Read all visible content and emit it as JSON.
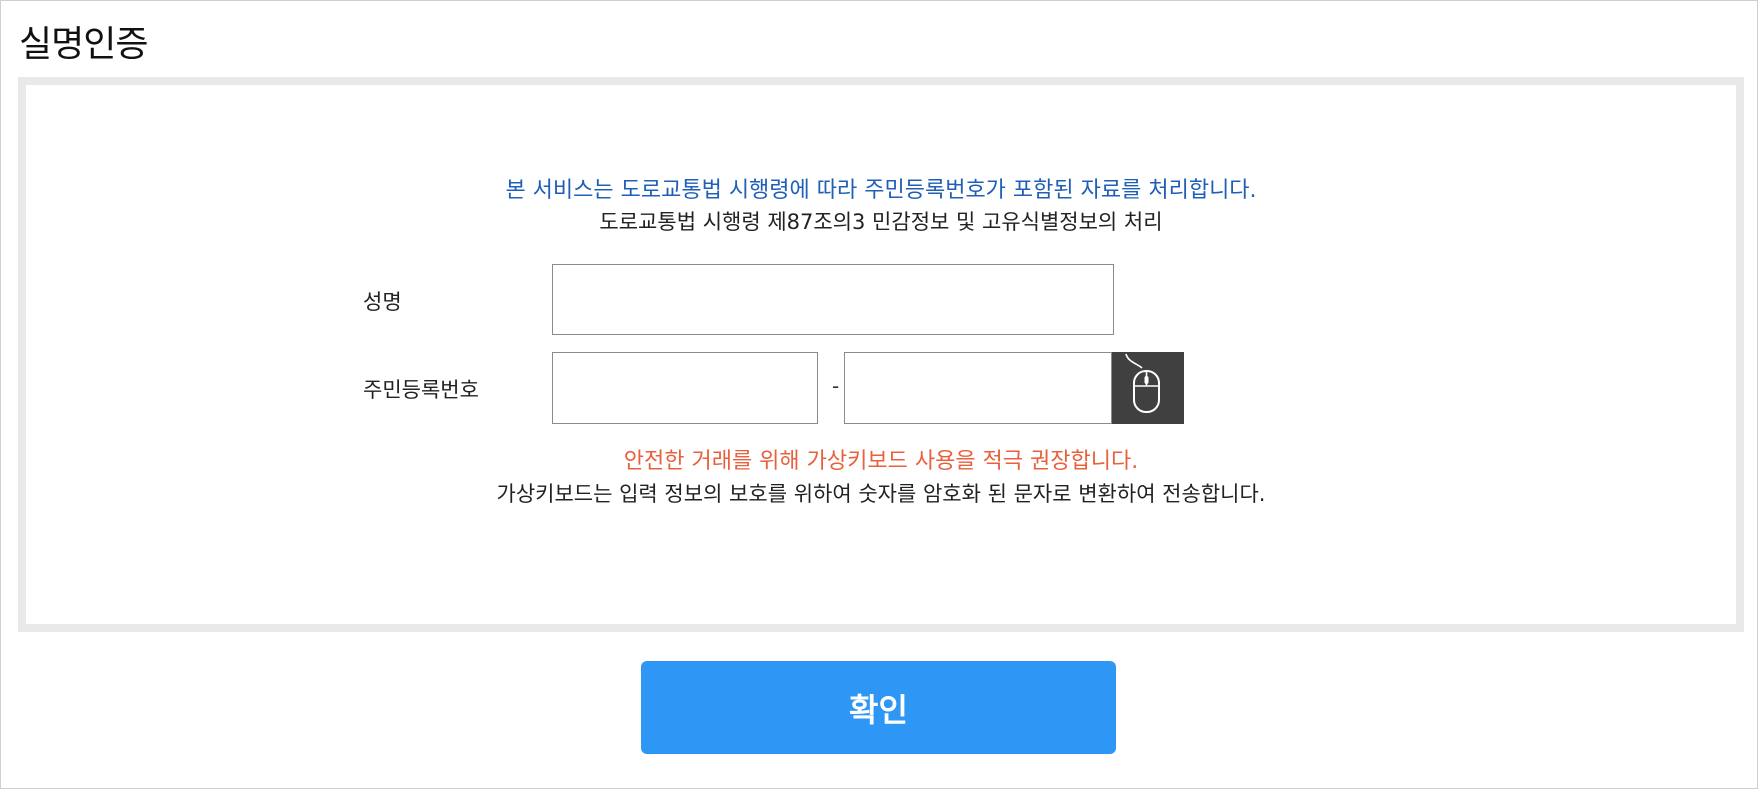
{
  "page": {
    "title": "실명인증"
  },
  "notice": {
    "service_text": "본 서비스는 도로교통법 시행령에 따라 주민등록번호가 포함된 자료를 처리합니다.",
    "legal_text": "도로교통법 시행령 제87조의3 민감정보 및 고유식별정보의 처리"
  },
  "form": {
    "name_label": "성명",
    "name_value": "",
    "rrn_label": "주민등록번호",
    "rrn_front_value": "",
    "rrn_separator": "-",
    "rrn_back_value": "",
    "virtual_keyboard_icon": "mouse-icon"
  },
  "security": {
    "warning_text": "안전한 거래를 위해 가상키보드 사용을 적극 권장합니다.",
    "info_text": "가상키보드는 입력 정보의 보호를 위하여 숫자를 암호화 된 문자로 변환하여 전송합니다."
  },
  "actions": {
    "confirm_label": "확인"
  },
  "colors": {
    "notice_blue": "#1f5fb8",
    "warning_red": "#e8603c",
    "button_blue": "#2e96f4",
    "keyboard_button_bg": "#404040",
    "panel_border": "#e9e9e9"
  }
}
